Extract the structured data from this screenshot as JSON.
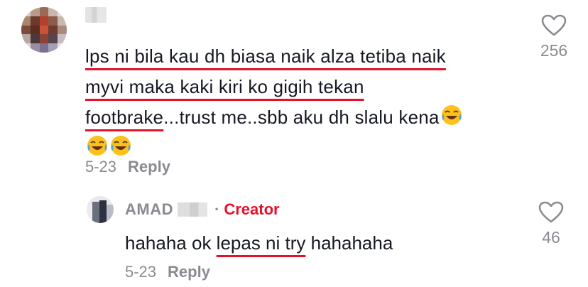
{
  "comment": {
    "text_parts": {
      "line1": "lps ni bila kau dh biasa naik alza tetiba naik",
      "line2": "myvi maka kaki kiri ko gigih tekan",
      "footbrake": "footbrake",
      "rest": "...trust me..sbb aku dh slalu kena"
    },
    "emoji_icon": "face-with-tears-of-joy-icon",
    "date": "5-23",
    "reply_label": "Reply",
    "like_count": "256"
  },
  "reply": {
    "author": "AMAD",
    "separator": "·",
    "creator_badge": "Creator",
    "text_before": "hahaha ok ",
    "text_underlined": "lepas ni try",
    "text_after": " hahahaha",
    "date": "5-23",
    "reply_label": "Reply",
    "like_count": "46"
  },
  "colors": {
    "text": "#161823",
    "secondary": "#8a8b91",
    "accent": "#e5112b"
  }
}
